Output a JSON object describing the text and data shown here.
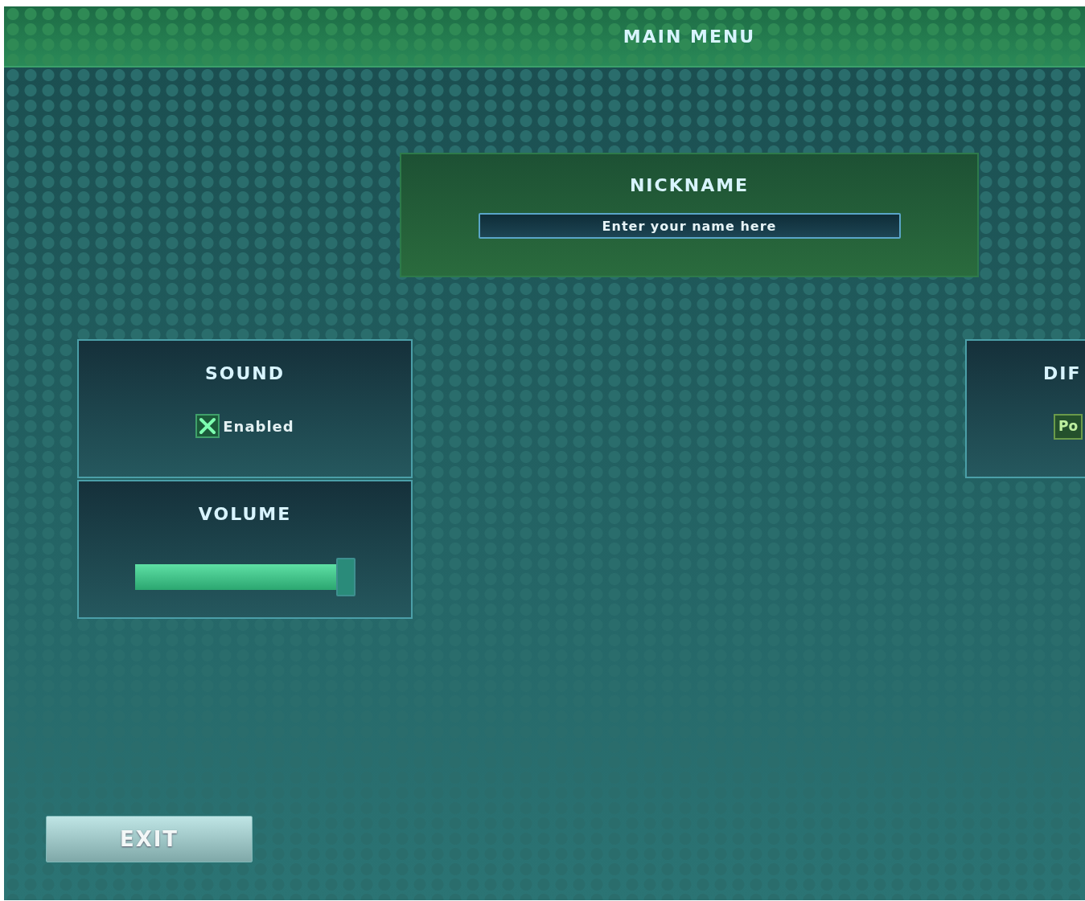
{
  "header": {
    "title": "MAIN MENU"
  },
  "nickname": {
    "title": "NICKNAME",
    "placeholder": "Enter your name here"
  },
  "sound": {
    "title": "SOUND",
    "checkbox": {
      "label": "Enabled",
      "checked": true
    }
  },
  "volume": {
    "title": "VOLUME",
    "level": 1
  },
  "difficulty": {
    "title": "DIF",
    "value": "Po"
  },
  "exit_button": {
    "label": "EXIT"
  }
}
